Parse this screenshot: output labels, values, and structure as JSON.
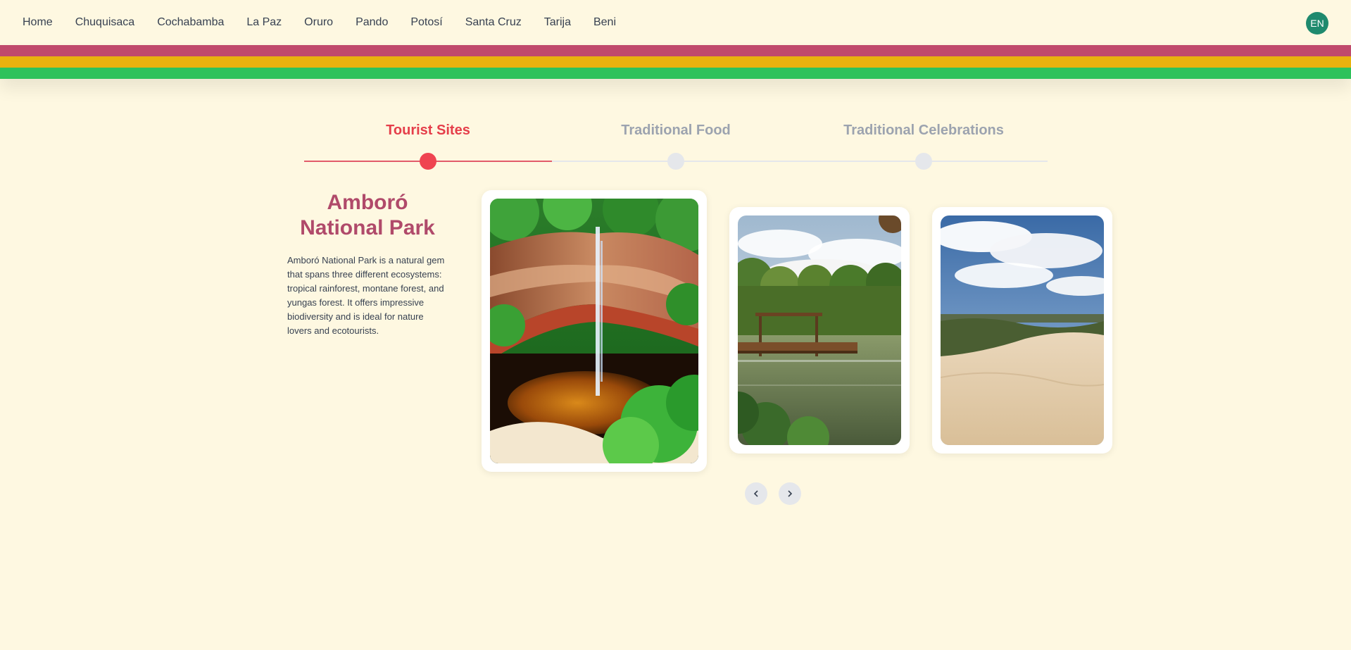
{
  "nav": {
    "links": [
      "Home",
      "Chuquisaca",
      "Cochabamba",
      "La Paz",
      "Oruro",
      "Pando",
      "Potosí",
      "Santa Cruz",
      "Tarija",
      "Beni"
    ],
    "language": "EN"
  },
  "flag_colors": [
    "#c04a6c",
    "#e9b20e",
    "#2ec25b"
  ],
  "tabs": [
    {
      "label": "Tourist Sites",
      "active": true
    },
    {
      "label": "Traditional Food",
      "active": false
    },
    {
      "label": "Traditional Celebrations",
      "active": false
    }
  ],
  "site": {
    "title": "Amboró National Park",
    "description": "Amboró National Park is a natural gem that spans three different ecosystems: tropical rainforest, montane forest, and yungas forest. It offers impressive biodiversity and is ideal for nature lovers and ecotourists."
  },
  "gallery": {
    "images": [
      "waterfall-photo",
      "lake-pier-photo",
      "sand-dunes-photo"
    ]
  },
  "controls": {
    "prev_icon": "chevron-left-icon",
    "next_icon": "chevron-right-icon"
  },
  "colors": {
    "background": "#fef8e1",
    "accent": "#e53e4a",
    "title": "#b04a6a",
    "language_badge": "#1f8a6e"
  }
}
